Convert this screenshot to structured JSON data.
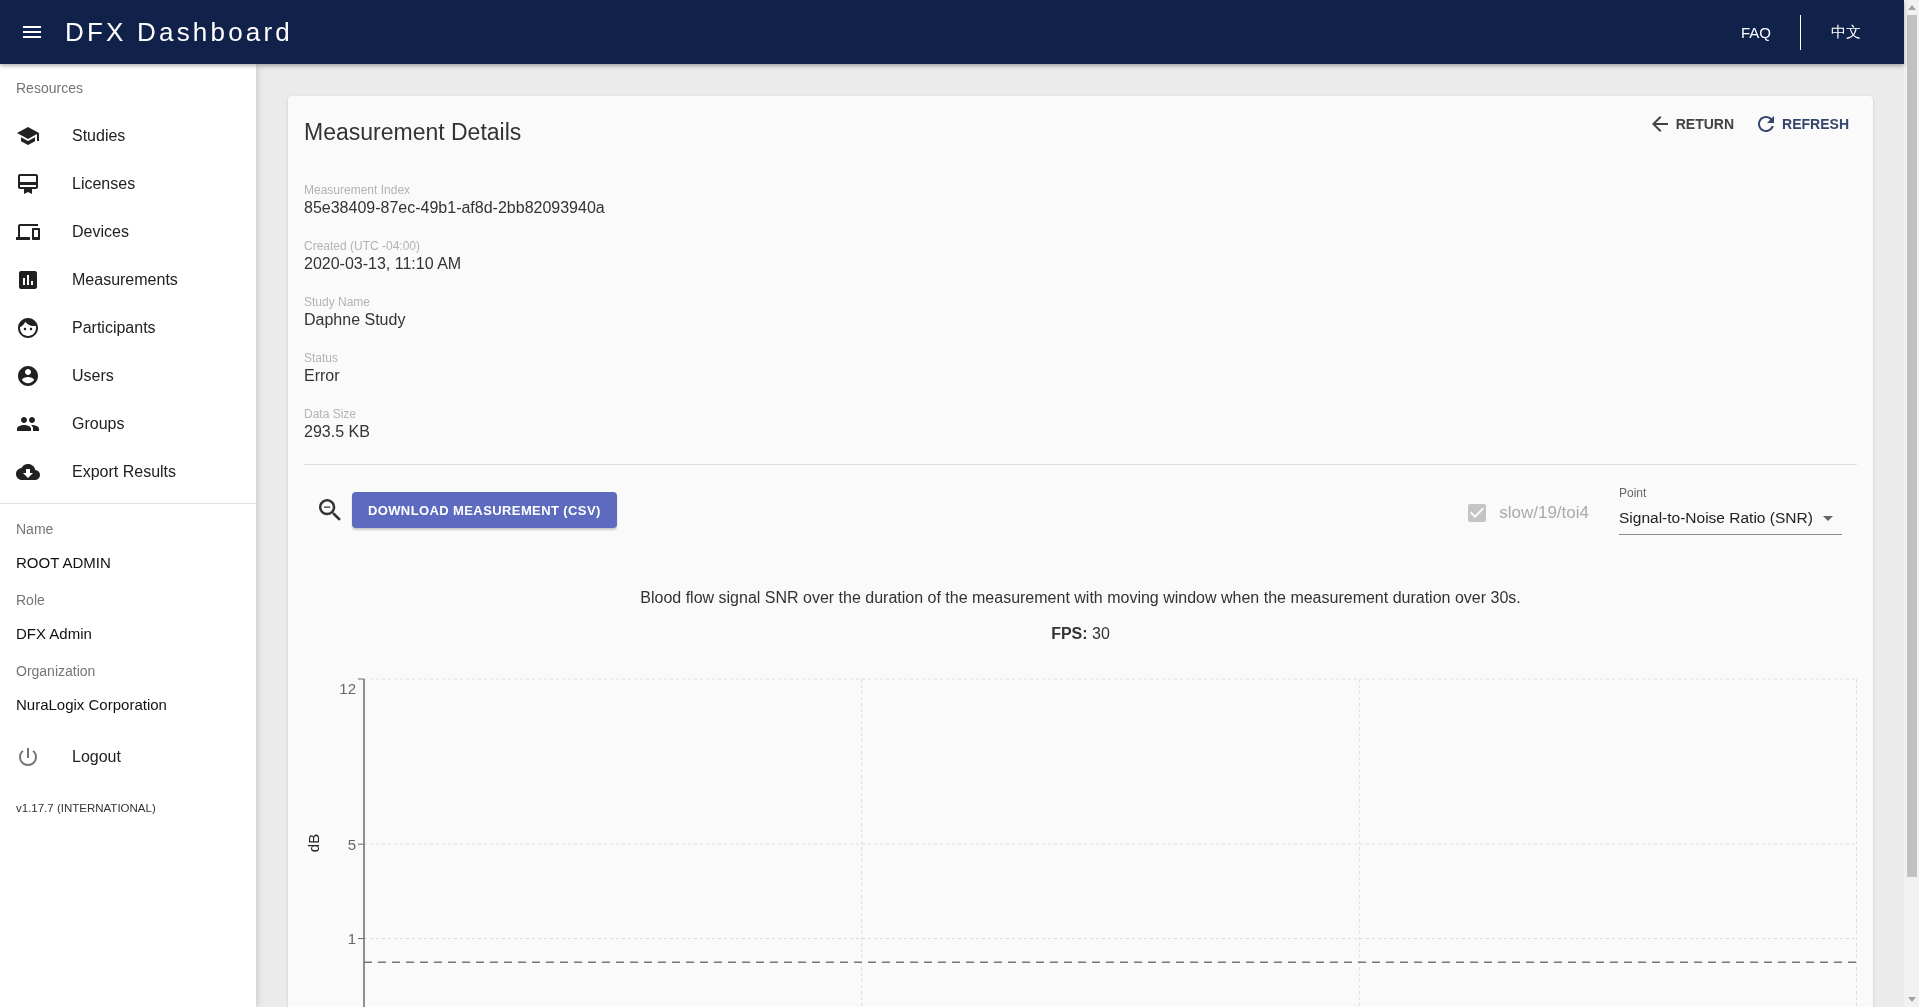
{
  "header": {
    "title": "DFX Dashboard",
    "links": [
      {
        "label": "FAQ"
      },
      {
        "label": "中文"
      }
    ]
  },
  "sidebar": {
    "section_title": "Resources",
    "items": [
      {
        "kind": "studies",
        "label": "Studies",
        "selected": false
      },
      {
        "kind": "licenses",
        "label": "Licenses",
        "selected": false
      },
      {
        "kind": "devices",
        "label": "Devices",
        "selected": false
      },
      {
        "kind": "measurements",
        "label": "Measurements",
        "selected": false
      },
      {
        "kind": "participants",
        "label": "Participants",
        "selected": false
      },
      {
        "kind": "users",
        "label": "Users",
        "selected": false
      },
      {
        "kind": "groups",
        "label": "Groups",
        "selected": false
      },
      {
        "kind": "export",
        "label": "Export Results",
        "selected": false
      }
    ],
    "profile": [
      {
        "label": "Name",
        "value": "ROOT ADMIN"
      },
      {
        "label": "Role",
        "value": "DFX Admin"
      },
      {
        "label": "Organization",
        "value": "NuraLogix Corporation"
      }
    ],
    "logout": "Logout",
    "version": "v1.17.7 (INTERNATIONAL)"
  },
  "details": {
    "title": "Measurement Details",
    "actions": [
      {
        "kind": "return",
        "label": "RETURN"
      },
      {
        "kind": "refresh",
        "label": "REFRESH"
      }
    ],
    "fields": [
      {
        "label": "Measurement Index",
        "value": "85e38409-87ec-49b1-af8d-2bb82093940a"
      },
      {
        "label": "Created (UTC -04:00)",
        "value": "2020-03-13, 11:10 AM"
      },
      {
        "label": "Study Name",
        "value": "Daphne Study"
      },
      {
        "label": "Status",
        "value": "Error"
      },
      {
        "label": "Data Size",
        "value": "293.5 KB"
      }
    ],
    "download_button": "DOWNLOAD MEASUREMENT (CSV)",
    "series_toggle": {
      "label": "slow/19/toi4",
      "checked": true,
      "disabled": true
    },
    "point_select": {
      "label": "Point",
      "value": "Signal-to-Noise Ratio (SNR)"
    },
    "description": "Blood flow signal SNR over the duration of the measurement with moving window when the measurement duration over 30s.",
    "fps": "**FPS:** 30",
    "chart_data": {
      "type": "line",
      "ylabel": "dB",
      "categories": [
        null,
        null,
        null,
        null
      ],
      "ylim": [
        -1.9,
        12
      ],
      "yticks": [
        1,
        5,
        12
      ],
      "grid": true,
      "series": [
        {
          "color": "#777777",
          "line_style": "dashed",
          "values": [
            0,
            0,
            0,
            0
          ]
        }
      ]
    }
  }
}
